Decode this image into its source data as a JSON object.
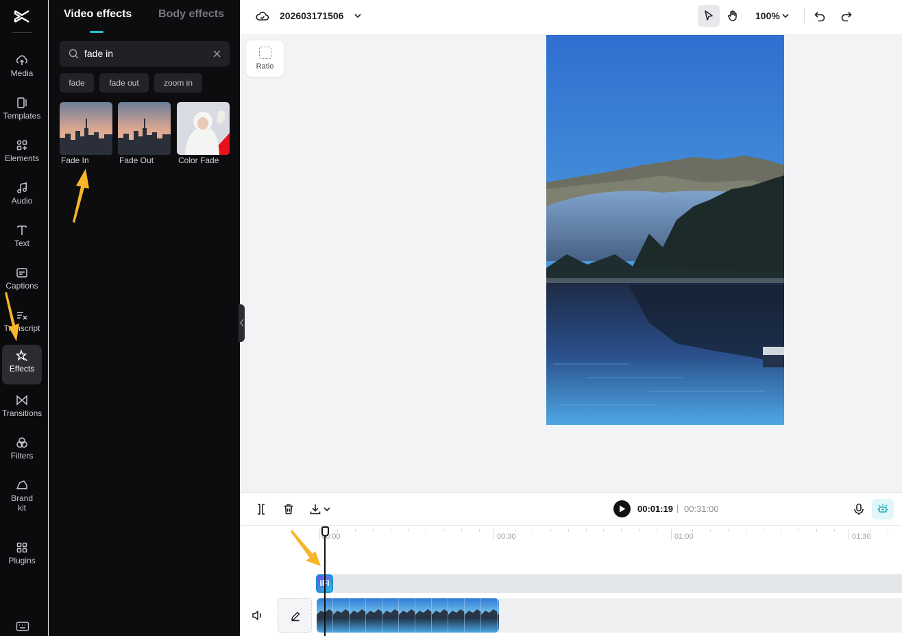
{
  "rail": {
    "items": [
      {
        "label": "Media",
        "icon": "cloud-upload-icon"
      },
      {
        "label": "Templates",
        "icon": "templates-icon"
      },
      {
        "label": "Elements",
        "icon": "elements-icon"
      },
      {
        "label": "Audio",
        "icon": "music-note-icon"
      },
      {
        "label": "Text",
        "icon": "text-icon"
      },
      {
        "label": "Captions",
        "icon": "captions-icon"
      },
      {
        "label": "Transcript",
        "icon": "transcript-icon"
      },
      {
        "label": "Effects",
        "icon": "effects-star-icon",
        "active": true
      },
      {
        "label": "Transitions",
        "icon": "transitions-icon"
      },
      {
        "label": "Filters",
        "icon": "filters-icon"
      },
      {
        "label": "Brand kit",
        "icon": "brand-kit-icon"
      },
      {
        "label": "Plugins",
        "icon": "plugins-grid-icon"
      }
    ]
  },
  "panel": {
    "tabs": [
      {
        "label": "Video effects",
        "active": true
      },
      {
        "label": "Body effects",
        "active": false
      }
    ],
    "search": {
      "value": "fade in"
    },
    "suggestions": [
      "fade",
      "fade out",
      "zoom in"
    ],
    "results": [
      {
        "label": "Fade In"
      },
      {
        "label": "Fade Out"
      },
      {
        "label": "Color Fade"
      }
    ]
  },
  "topbar": {
    "project_name": "202603171506",
    "zoom": "100%"
  },
  "canvas": {
    "ratio_label": "Ratio"
  },
  "timeline": {
    "current_time": "00:01:19",
    "separator": "|",
    "total_time": "00:31:00",
    "ruler_labels": [
      "00:00",
      "00:30",
      "01:00",
      "01:30"
    ],
    "effect_clip_label": "IFI"
  },
  "colors": {
    "accent": "#22c3d6",
    "annotation_arrow": "#f7b529"
  }
}
